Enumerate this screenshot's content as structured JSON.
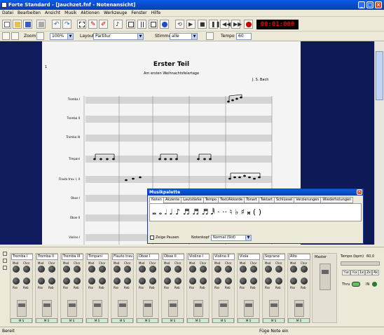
{
  "window": {
    "title": "Forte Standard - [Jauchzet.fnf - Notenansicht]"
  },
  "menu": [
    "Datei",
    "Bearbeiten",
    "Ansicht",
    "Musik",
    "Aktionen",
    "Werkzeuge",
    "Fenster",
    "Hilfe"
  ],
  "transport": {
    "time": "00:01:000"
  },
  "toolbar2": {
    "zoom_label": "Zoom",
    "zoom_value": "100%",
    "layout_label": "Layout",
    "layout_value": "Partitur",
    "stimme_label": "Stimme",
    "stimme_value": "alle",
    "tempo_label": "Tempo",
    "tempo_value": "60"
  },
  "score": {
    "page_number": "1",
    "title": "Erster Teil",
    "subtitle": "Am ersten Weihnachtsfeiertage",
    "composer": "J. S. Bach",
    "instruments": [
      "Tromba I",
      "Tromba II",
      "Tromba III",
      "Timpani",
      "Flauto trav. I, II",
      "Oboe I",
      "Oboe II",
      "Violino I"
    ]
  },
  "palette": {
    "title": "Musikpalette",
    "tabs": [
      "Noten",
      "Akzente",
      "Lautstärke",
      "Tempo",
      "Text/Akkorde",
      "Tonart",
      "Taktart",
      "Schlüssel",
      "Verzierungen",
      "Wiederholungen"
    ],
    "symbols": "𝅜 𝅝 𝅗𝅥 ♩ ♪ ♬ ♬ ♬ 𝅘𝅥𝅱 · ·· ♮ ♭ ♯ 𝄪 ( )",
    "show_rests_label": "Zeige Pausen",
    "notehead_label": "Notenkopf",
    "notehead_value": "Normal (Std)"
  },
  "mixer": {
    "channels": [
      "Tromba I",
      "Tromba II",
      "Tromba III",
      "Timpani",
      "Flauto trav. I",
      "Oboe I",
      "Oboe II",
      "Violino I",
      "Violino II",
      "Viola",
      "Soprano",
      "Alto"
    ],
    "knob_labels": {
      "mod": "Mod",
      "chor": "Chor",
      "pan": "Pan",
      "reverb": "Reb"
    },
    "master_label": "Master",
    "tempo_label": "Tempo (bpm)",
    "tempo_value": "60,0",
    "speed_buttons": [
      "¼x",
      "½x",
      "1x",
      "2x",
      "4x"
    ],
    "thru_label": "Thru",
    "in_label": "IN"
  },
  "status": {
    "left": "Bereit",
    "middle": "Füge Note ein"
  }
}
